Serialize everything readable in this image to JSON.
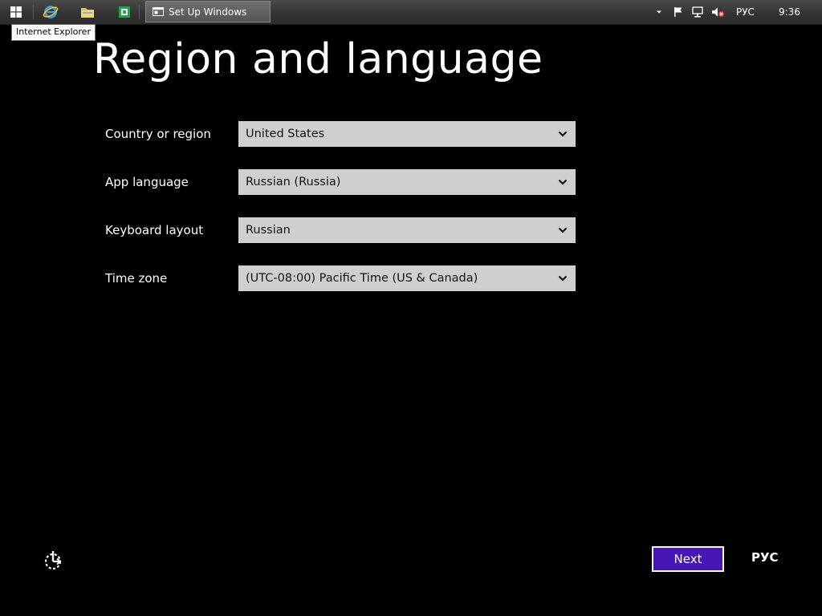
{
  "taskbar": {
    "setup_window_label": "Set Up Windows",
    "tray": {
      "language": "РУС",
      "time": "9:36"
    }
  },
  "tooltip": "Internet Explorer",
  "page": {
    "title": "Region and language",
    "fields": [
      {
        "label": "Country or region",
        "value": "United States"
      },
      {
        "label": "App language",
        "value": "Russian (Russia)"
      },
      {
        "label": "Keyboard layout",
        "value": "Russian"
      },
      {
        "label": "Time zone",
        "value": "(UTC-08:00) Pacific Time (US & Canada)"
      }
    ]
  },
  "footer": {
    "next_label": "Next",
    "language_indicator": "РУС"
  },
  "colors": {
    "background": "#000000",
    "next_button": "#4617b4",
    "select_bg": "#cfcfcf"
  }
}
